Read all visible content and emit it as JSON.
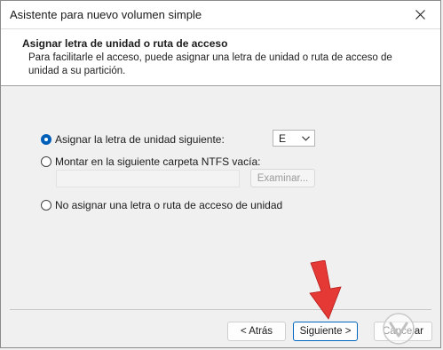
{
  "window": {
    "title": "Asistente para nuevo volumen simple"
  },
  "header": {
    "title": "Asignar letra de unidad o ruta de acceso",
    "description": "Para facilitarle el acceso, puede asignar una letra de unidad o ruta de acceso de unidad a su partición."
  },
  "options": {
    "assign_letter": {
      "label": "Asignar la letra de unidad siguiente:",
      "checked": true
    },
    "mount_folder": {
      "label": "Montar en la siguiente carpeta NTFS vacía:",
      "checked": false
    },
    "no_assign": {
      "label": "No asignar una letra o ruta de acceso de unidad",
      "checked": false
    }
  },
  "drive_letter": {
    "value": "E"
  },
  "folder_path": {
    "value": ""
  },
  "browse_button": {
    "label": "Examinar..."
  },
  "footer": {
    "back_label": "< Atrás",
    "next_label": "Siguiente >",
    "cancel_label": "Cancelar"
  },
  "colors": {
    "accent": "#0067c0",
    "arrow": "#e53935"
  },
  "icons": {
    "close": "close-icon",
    "dropdown": "chevron-down-icon",
    "annotation": "red-arrow-icon",
    "watermark": "watermark-logo"
  }
}
